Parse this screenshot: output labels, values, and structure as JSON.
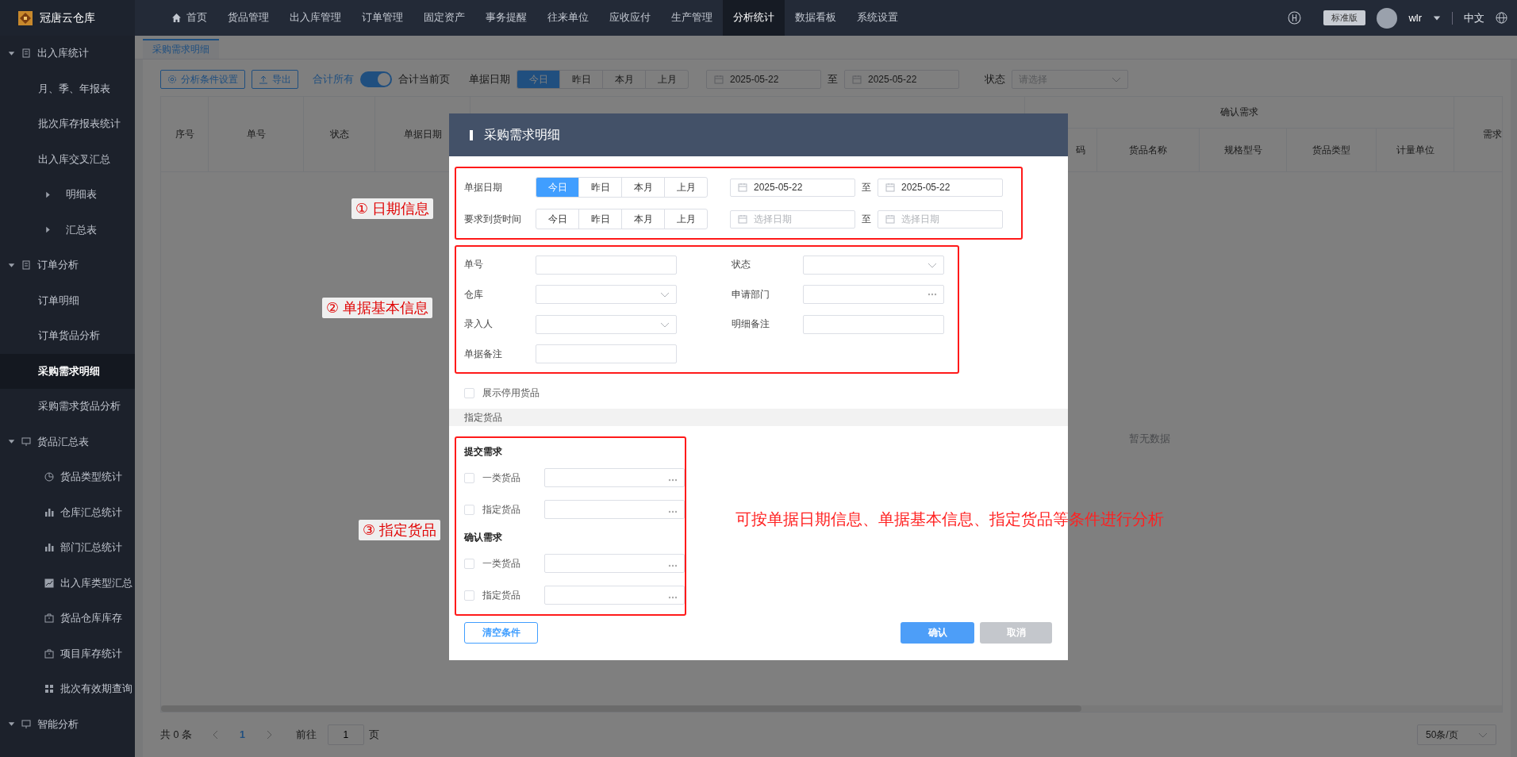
{
  "app": {
    "name": "冠唐云仓库"
  },
  "nav": [
    {
      "label": "首页",
      "selected": false
    },
    {
      "label": "货品管理",
      "selected": false
    },
    {
      "label": "出入库管理",
      "selected": false
    },
    {
      "label": "订单管理",
      "selected": false
    },
    {
      "label": "固定资产",
      "selected": false
    },
    {
      "label": "事务提醒",
      "selected": false
    },
    {
      "label": "往来单位",
      "selected": false
    },
    {
      "label": "应收应付",
      "selected": false
    },
    {
      "label": "生产管理",
      "selected": false
    },
    {
      "label": "分析统计",
      "selected": true
    },
    {
      "label": "数据看板",
      "selected": false
    },
    {
      "label": "系统设置",
      "selected": false
    }
  ],
  "header": {
    "edition": "标准版",
    "user": "wlr",
    "language": "中文"
  },
  "sidebar": [
    {
      "label": "出入库统计",
      "expanded": true,
      "children": [
        {
          "label": "月、季、年报表",
          "selected": false
        },
        {
          "label": "批次库存报表统计",
          "selected": false
        },
        {
          "label": "出入库交叉汇总",
          "selected": false
        },
        {
          "label": "明细表",
          "selected": false,
          "expanded": false
        },
        {
          "label": "汇总表",
          "selected": false,
          "expanded": false
        }
      ]
    },
    {
      "label": "订单分析",
      "expanded": true,
      "children": [
        {
          "label": "订单明细",
          "selected": false
        },
        {
          "label": "订单货品分析",
          "selected": false
        },
        {
          "label": "采购需求明细",
          "selected": true
        },
        {
          "label": "采购需求货品分析",
          "selected": false
        }
      ]
    },
    {
      "label": "货品汇总表",
      "expanded": true,
      "children": [
        {
          "label": "货品类型统计",
          "selected": false
        },
        {
          "label": "仓库汇总统计",
          "selected": false
        },
        {
          "label": "部门汇总统计",
          "selected": false
        },
        {
          "label": "出入库类型汇总",
          "selected": false
        },
        {
          "label": "货品仓库库存",
          "selected": false
        },
        {
          "label": "项目库存统计",
          "selected": false
        },
        {
          "label": "批次有效期查询",
          "selected": false
        }
      ]
    },
    {
      "label": "智能分析",
      "expanded": true
    }
  ],
  "tabs": [
    {
      "label": "采购需求明细",
      "selected": true
    }
  ],
  "toolbar": {
    "settings_button": "分析条件设置",
    "export_button": "导出",
    "sum_all_label": "合计所有",
    "sum_toggle": {
      "on": true
    },
    "sum_page_label": "合计当前页",
    "date_label": "单据日期",
    "date_options": [
      {
        "label": "今日",
        "selected": true
      },
      {
        "label": "昨日",
        "selected": false
      },
      {
        "label": "本月",
        "selected": false
      },
      {
        "label": "上月",
        "selected": false
      }
    ],
    "date_from": "2025-05-22",
    "date_sep": "至",
    "date_to": "2025-05-22",
    "status_label": "状态",
    "status_placeholder": "请选择"
  },
  "table": {
    "fixed_columns": [
      "序号",
      "单号",
      "状态",
      "单据日期"
    ],
    "group": {
      "title": "确认需求",
      "columns": [
        "码",
        "货品名称",
        "规格型号",
        "货品类型",
        "计量单位"
      ]
    },
    "trailing_column": "需求",
    "empty_text": "暂无数据"
  },
  "pagination": {
    "total": "共 0 条",
    "pages": [
      {
        "label": "1",
        "selected": true
      }
    ],
    "goto_label": "前往",
    "goto_value": "1",
    "page_unit": "页",
    "page_size": "50条/页"
  },
  "dialog": {
    "title": "采购需求明细",
    "date_rows": [
      {
        "label": "单据日期",
        "options": [
          {
            "label": "今日",
            "selected": true
          },
          {
            "label": "昨日",
            "selected": false
          },
          {
            "label": "本月",
            "selected": false
          },
          {
            "label": "上月",
            "selected": false
          }
        ],
        "from": {
          "value": "2025-05-22"
        },
        "sep": "至",
        "to": {
          "value": "2025-05-22"
        }
      },
      {
        "label": "要求到货时间",
        "options": [
          {
            "label": "今日",
            "selected": false
          },
          {
            "label": "昨日",
            "selected": false
          },
          {
            "label": "本月",
            "selected": false
          },
          {
            "label": "上月",
            "selected": false
          }
        ],
        "from": {
          "placeholder": "选择日期"
        },
        "sep": "至",
        "to": {
          "placeholder": "选择日期"
        }
      }
    ],
    "fields": [
      {
        "label": "单号",
        "kind": "text"
      },
      {
        "label": "状态",
        "kind": "select"
      },
      {
        "label": "仓库",
        "kind": "select"
      },
      {
        "label": "申请部门",
        "kind": "picker"
      },
      {
        "label": "录入人",
        "kind": "select"
      },
      {
        "label": "明细备注",
        "kind": "text"
      },
      {
        "label": "单据备注",
        "kind": "text"
      }
    ],
    "show_disabled": {
      "label": "展示停用货品",
      "checked": false
    },
    "goods_section": "指定货品",
    "goods_groups": [
      {
        "title": "提交需求",
        "rows": [
          {
            "label": "一类货品",
            "checked": false
          },
          {
            "label": "指定货品",
            "checked": false
          }
        ]
      },
      {
        "title": "确认需求",
        "rows": [
          {
            "label": "一类货品",
            "checked": false
          },
          {
            "label": "指定货品",
            "checked": false
          }
        ]
      }
    ],
    "buttons": {
      "clear": "清空条件",
      "confirm": "确认",
      "cancel": "取消"
    }
  },
  "annotations": {
    "labels": [
      "① 日期信息",
      "② 单据基本信息",
      "③ 指定货品"
    ],
    "note": "可按单据日期信息、单据基本信息、指定货品等条件进行分析"
  }
}
